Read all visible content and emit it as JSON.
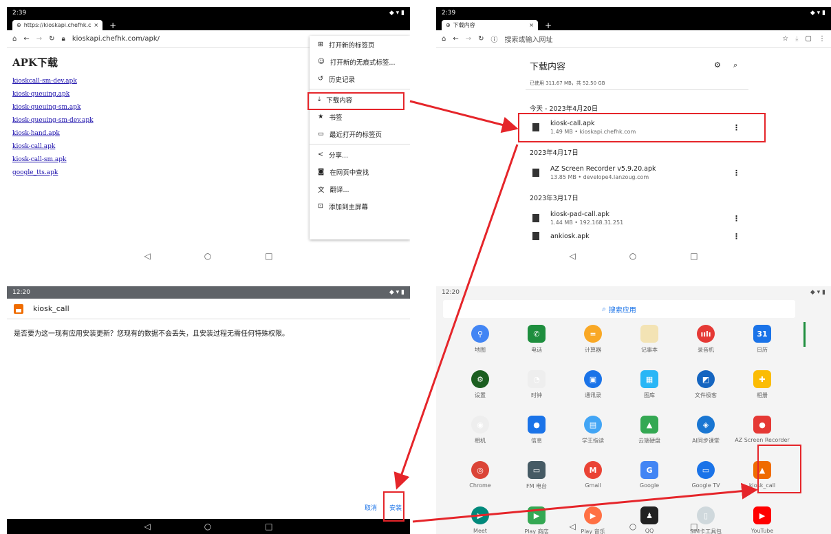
{
  "p1": {
    "time": "2:39",
    "tab_title": "https://kioskapi.chefhk.c",
    "url": "kioskapi.chefhk.com/apk/",
    "page_title": "APK下载",
    "links": [
      "kioskcall-sm-dev.apk",
      "kiosk-queuing.apk",
      "kiosk-queuing-sm.apk",
      "kiosk-queuing-sm-dev.apk",
      "kiosk-hand.apk",
      "kiosk-call.apk",
      "kiosk-call-sm.apk",
      "google_tts.apk"
    ],
    "menu": [
      "打开新的标签页",
      "打开新的无痕式标签...",
      "历史记录",
      "下载内容",
      "书签",
      "最近打开的标签页",
      "分享...",
      "在网页中查找",
      "翻译...",
      "添加到主屏幕"
    ]
  },
  "p2": {
    "time": "2:39",
    "tab_title": "下载内容",
    "url": "搜索或输入网址",
    "title": "下载内容",
    "storage": "已使用 311.67 MB，共 52.50 GB",
    "groups": [
      {
        "date": "今天 - 2023年4月20日"
      },
      {
        "date": "2023年4月17日"
      },
      {
        "date": "2023年3月17日"
      }
    ],
    "items": [
      {
        "name": "kiosk-call.apk",
        "meta": "1.49 MB • kioskapi.chefhk.com"
      },
      {
        "name": "AZ Screen Recorder v5.9.20.apk",
        "meta": "13.85 MB • develope4.lanzoug.com"
      },
      {
        "name": "kiosk-pad-call.apk",
        "meta": "1.44 MB • 192.168.31.251"
      },
      {
        "name": "ankiosk.apk",
        "meta": ""
      }
    ]
  },
  "p3": {
    "time": "12:20",
    "app_name": "kiosk_call",
    "message": "是否要为这一现有应用安装更新？您现有的数据不会丢失，且安装过程无需任何特殊权限。",
    "cancel": "取消",
    "install": "安装"
  },
  "p4": {
    "time": "12:20",
    "search": "搜索应用",
    "apps": [
      {
        "label": "地图",
        "color": "#4285f4",
        "glyph": "⚲"
      },
      {
        "label": "电话",
        "color": "#1e8e3e",
        "glyph": "✆"
      },
      {
        "label": "计算器",
        "color": "#f9a825",
        "glyph": "="
      },
      {
        "label": "记事本",
        "color": "#f3e3b4",
        "glyph": ""
      },
      {
        "label": "录音机",
        "color": "#e53935",
        "glyph": "ıılı"
      },
      {
        "label": "日历",
        "color": "#1a73e8",
        "glyph": "31"
      },
      {
        "label": "设置",
        "color": "#1b5e20",
        "glyph": "⚙"
      },
      {
        "label": "时钟",
        "color": "#eeeeee",
        "glyph": "◔"
      },
      {
        "label": "通讯录",
        "color": "#1a73e8",
        "glyph": "▣"
      },
      {
        "label": "图库",
        "color": "#29b6f6",
        "glyph": "▦"
      },
      {
        "label": "文件极客",
        "color": "#1565c0",
        "glyph": "◩"
      },
      {
        "label": "相册",
        "color": "#fbbc04",
        "glyph": "✚"
      },
      {
        "label": "相机",
        "color": "#eeeeee",
        "glyph": "◉"
      },
      {
        "label": "信息",
        "color": "#1a73e8",
        "glyph": "●"
      },
      {
        "label": "学王指读",
        "color": "#42a5f5",
        "glyph": "▤"
      },
      {
        "label": "云端硬盘",
        "color": "#34a853",
        "glyph": "▲"
      },
      {
        "label": "AI同步课堂",
        "color": "#1976d2",
        "glyph": "◈"
      },
      {
        "label": "AZ Screen Recorder",
        "color": "#e53935",
        "glyph": "●"
      },
      {
        "label": "Chrome",
        "color": "#db4437",
        "glyph": "◎"
      },
      {
        "label": "FM 电台",
        "color": "#455a64",
        "glyph": "▭"
      },
      {
        "label": "Gmail",
        "color": "#ea4335",
        "glyph": "M"
      },
      {
        "label": "Google",
        "color": "#4285f4",
        "glyph": "G"
      },
      {
        "label": "Google TV",
        "color": "#1a73e8",
        "glyph": "▭"
      },
      {
        "label": "kiosk_call",
        "color": "#ef6c00",
        "glyph": "▲"
      },
      {
        "label": "Meet",
        "color": "#00897b",
        "glyph": "▶"
      },
      {
        "label": "Play 商店",
        "color": "#34a853",
        "glyph": "▶"
      },
      {
        "label": "Play 音乐",
        "color": "#ff7043",
        "glyph": "▶"
      },
      {
        "label": "QQ",
        "color": "#222222",
        "glyph": "♟"
      },
      {
        "label": "SIM卡工具包",
        "color": "#cfd8dc",
        "glyph": "▯"
      },
      {
        "label": "YouTube",
        "color": "#ff0000",
        "glyph": "▶"
      }
    ]
  }
}
